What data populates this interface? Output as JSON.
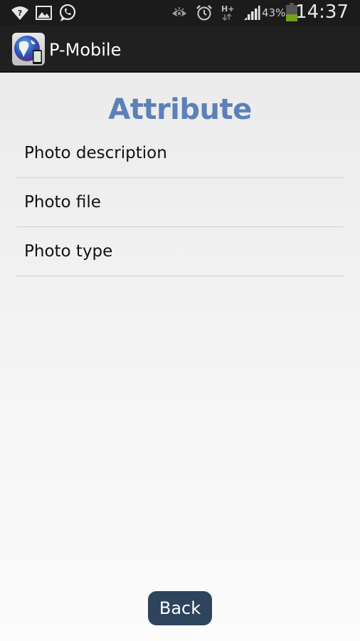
{
  "status_bar": {
    "left_icons": [
      "wifi-question-icon",
      "gallery-icon",
      "whatsapp-icon"
    ],
    "right_icons": [
      "eye-icon",
      "alarm-icon",
      "hplus-data-icon",
      "signal-icon",
      "battery-icon"
    ],
    "network_label": "H+",
    "battery_percent": "43%",
    "battery_level": 0.43,
    "time": "14:37"
  },
  "action_bar": {
    "app_title": "P-Mobile",
    "app_icon": "globe-phone-icon"
  },
  "main": {
    "title": "Attribute",
    "items": [
      {
        "label": "Photo description"
      },
      {
        "label": "Photo file"
      },
      {
        "label": "Photo type"
      }
    ],
    "back_label": "Back"
  },
  "colors": {
    "title_color": "#5c80b8",
    "button_color": "#2d445c",
    "battery_fill": "#6ea31a"
  }
}
